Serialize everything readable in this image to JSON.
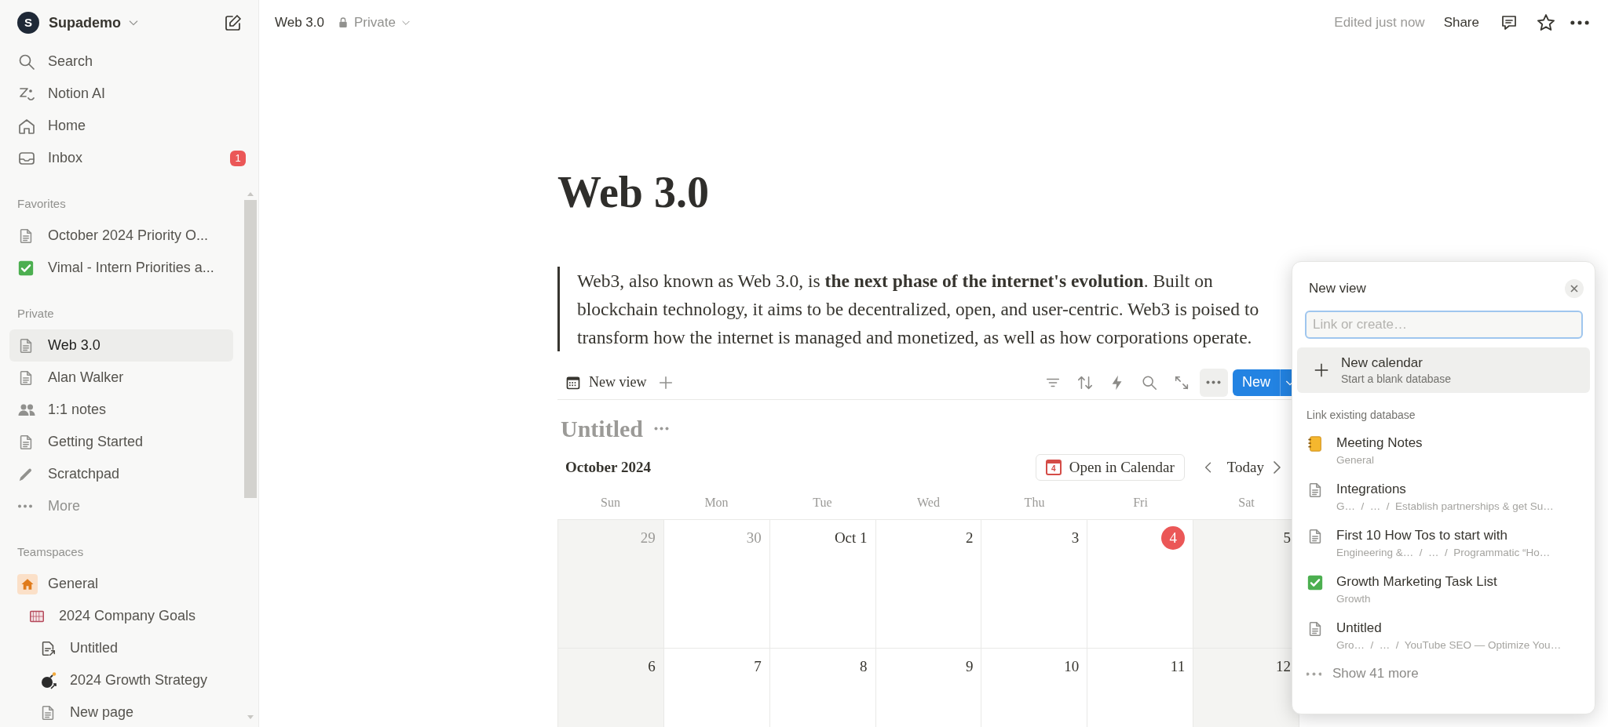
{
  "sidebar": {
    "workspace": {
      "initial": "S",
      "name": "Supademo"
    },
    "nav": [
      {
        "kind": "search",
        "label": "Search"
      },
      {
        "kind": "ai",
        "label": "Notion AI"
      },
      {
        "kind": "home",
        "label": "Home"
      },
      {
        "kind": "inbox",
        "label": "Inbox",
        "badge": "1"
      }
    ],
    "sections": [
      {
        "heading": "Favorites",
        "items": [
          {
            "kind": "page",
            "label": "October 2024 Priority O...",
            "selected": false
          },
          {
            "kind": "checkbox",
            "label": "Vimal - Intern Priorities a...",
            "selected": false
          }
        ]
      },
      {
        "heading": "Private",
        "items": [
          {
            "kind": "page",
            "label": "Web 3.0",
            "selected": true
          },
          {
            "kind": "page",
            "label": "Alan Walker",
            "selected": false
          },
          {
            "kind": "people",
            "label": "1:1 notes",
            "selected": false
          },
          {
            "kind": "page",
            "label": "Getting Started",
            "selected": false
          },
          {
            "kind": "pencil",
            "label": "Scratchpad",
            "selected": false
          },
          {
            "kind": "more",
            "label": "More",
            "selected": false
          }
        ]
      },
      {
        "heading": "Teamspaces",
        "items": [
          {
            "kind": "house",
            "label": "General",
            "selected": false,
            "children": [
              {
                "kind": "goal",
                "label": "2024 Company Goals",
                "selected": false,
                "children": [
                  {
                    "kind": "linkpage",
                    "label": "Untitled",
                    "selected": false
                  },
                  {
                    "kind": "bomb",
                    "label": "2024 Growth Strategy",
                    "selected": false
                  },
                  {
                    "kind": "page",
                    "label": "New page",
                    "selected": false
                  }
                ]
              }
            ]
          }
        ]
      }
    ]
  },
  "topbar": {
    "breadcrumb": "Web 3.0",
    "privacy": "Private",
    "edited": "Edited just now",
    "share": "Share"
  },
  "page": {
    "title": "Web 3.0",
    "quote": "Web3, also known as Web 3.0, is **the next phase of the internet's evolution**. Built on blockchain technology, it aims to be decentralized, open, and user-centric. Web3 is poised to transform how the internet is managed and monetized, as well as how corporations operate.",
    "view_tab": "New view",
    "new_button": "New",
    "database_title": "Untitled",
    "calendar": {
      "month": "October 2024",
      "open_button": "Open in Calendar",
      "open_icon_day": "4",
      "today_button": "Today",
      "weekdays": [
        "Sun",
        "Mon",
        "Tue",
        "Wed",
        "Thu",
        "Fri",
        "Sat"
      ],
      "weeks": [
        [
          {
            "label": "29",
            "muted": true,
            "today": false,
            "weekend": true
          },
          {
            "label": "30",
            "muted": true,
            "today": false,
            "weekend": false
          },
          {
            "label": "Oct 1",
            "muted": false,
            "today": false,
            "weekend": false
          },
          {
            "label": "2",
            "muted": false,
            "today": false,
            "weekend": false
          },
          {
            "label": "3",
            "muted": false,
            "today": false,
            "weekend": false
          },
          {
            "label": "4",
            "muted": false,
            "today": true,
            "weekend": false
          },
          {
            "label": "5",
            "muted": false,
            "today": false,
            "weekend": true
          }
        ],
        [
          {
            "label": "6",
            "muted": false,
            "today": false,
            "weekend": true
          },
          {
            "label": "7",
            "muted": false,
            "today": false,
            "weekend": false
          },
          {
            "label": "8",
            "muted": false,
            "today": false,
            "weekend": false
          },
          {
            "label": "9",
            "muted": false,
            "today": false,
            "weekend": false
          },
          {
            "label": "10",
            "muted": false,
            "today": false,
            "weekend": false
          },
          {
            "label": "11",
            "muted": false,
            "today": false,
            "weekend": false
          },
          {
            "label": "12",
            "muted": false,
            "today": false,
            "weekend": true
          }
        ]
      ]
    }
  },
  "new_view_panel": {
    "title": "New view",
    "placeholder": "Link or create…",
    "create_option": {
      "label": "New calendar",
      "description": "Start a blank database",
      "highlighted": true
    },
    "section_heading": "Link existing database",
    "databases": [
      {
        "kind": "notebook",
        "name": "Meeting Notes",
        "path": "General"
      },
      {
        "kind": "page",
        "name": "Integrations",
        "path": "G…  /  …  /  Establish partnerships & get Su…"
      },
      {
        "kind": "page",
        "name": "First 10 How Tos to start with",
        "path": "Engineering &…  /  …  /  Programmatic “Ho…"
      },
      {
        "kind": "checkbox",
        "name": "Growth Marketing Task List",
        "path": "Growth"
      },
      {
        "kind": "page",
        "name": "Untitled",
        "path": "Gro…  /  …  /  YouTube SEO — Optimize You…"
      }
    ],
    "show_more": "Show 41 more"
  }
}
